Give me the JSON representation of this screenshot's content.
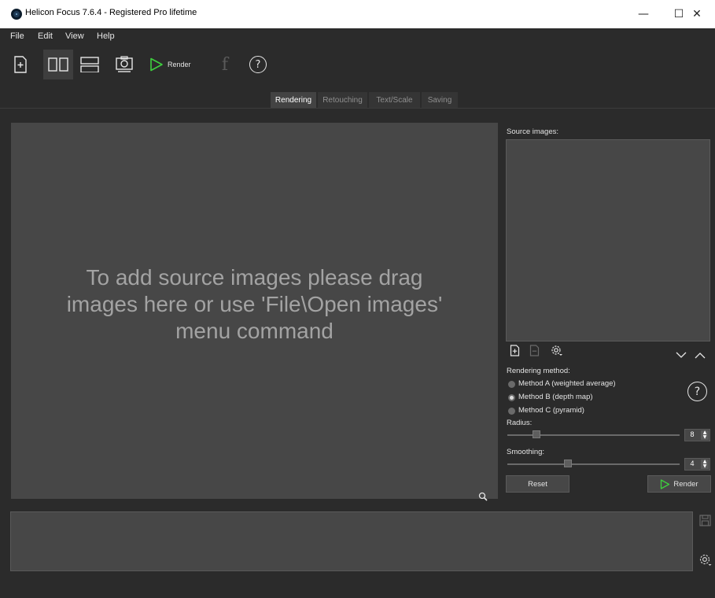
{
  "window": {
    "title": "Helicon Focus 7.6.4 - Registered Pro lifetime",
    "minimize_glyph": "—",
    "maximize_glyph": "☐",
    "close_glyph": "✕"
  },
  "menu": {
    "items": [
      {
        "label": "File"
      },
      {
        "label": "Edit"
      },
      {
        "label": "View"
      },
      {
        "label": "Help"
      }
    ]
  },
  "toolbar": {
    "render_label": "Render",
    "help_glyph": "?",
    "facebook_glyph": "f",
    "icons": [
      "add-file-icon",
      "two-column-icon",
      "two-row-icon",
      "camera-icon",
      "play-icon",
      "facebook-icon",
      "help-icon"
    ]
  },
  "tabs": [
    {
      "label": "Rendering",
      "active": true
    },
    {
      "label": "Retouching",
      "active": false
    },
    {
      "label": "Text/Scale",
      "active": false
    },
    {
      "label": "Saving",
      "active": false
    }
  ],
  "drop_area": {
    "line1": "To add source images please drag",
    "line2": "images here or use 'File\\Open images'",
    "line3": "menu command"
  },
  "right_panel": {
    "source_images_label": "Source images:",
    "rendering_method_label": "Rendering method:",
    "methods": [
      {
        "label": "Method A (weighted average)",
        "checked": false
      },
      {
        "label": "Method B (depth map)",
        "checked": true
      },
      {
        "label": "Method C (pyramid)",
        "checked": false
      }
    ],
    "radius_label": "Radius:",
    "radius_value": "8",
    "radius_fraction": 0.17,
    "smoothing_label": "Smoothing:",
    "smoothing_value": "4",
    "smoothing_fraction": 0.35,
    "reset_label": "Reset",
    "render_label": "Render",
    "help_glyph": "?"
  },
  "colors": {
    "accent_green": "#3ecf3e",
    "panel_bg": "#2b2b2b",
    "drop_bg": "#474747"
  }
}
